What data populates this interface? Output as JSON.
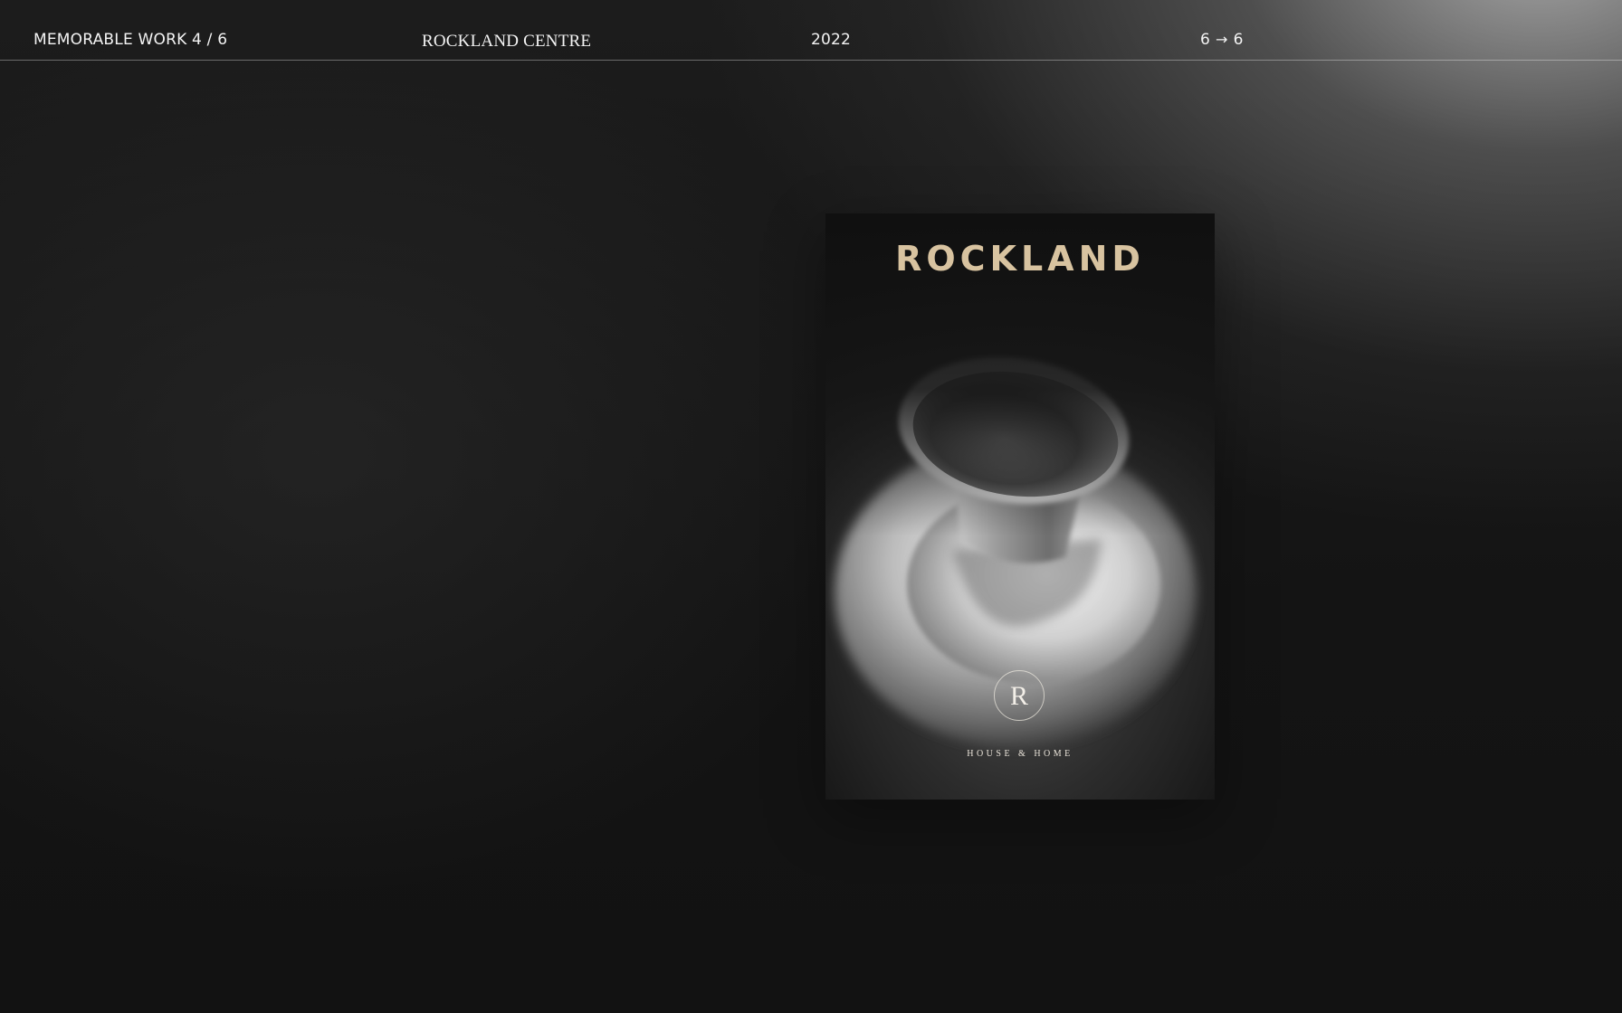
{
  "header": {
    "counter": "MEMORABLE WORK 4 / 6",
    "project_name": "ROCKLAND CENTRE",
    "year": "2022",
    "pager": {
      "from": "6",
      "arrow_icon": "arrow-right-icon",
      "to": "6"
    }
  },
  "poster": {
    "title": "ROCKLAND",
    "monogram": "R",
    "tagline": "HOUSE & HOME",
    "title_color": "#d8c3a0"
  }
}
